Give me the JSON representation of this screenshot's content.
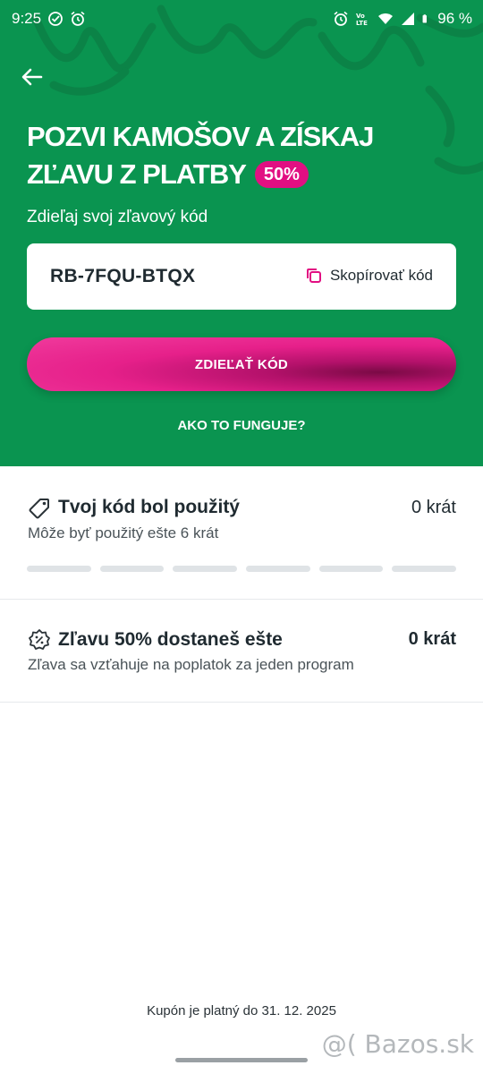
{
  "status_bar": {
    "time": "9:25",
    "battery": "96 %",
    "network": "Vo LTE"
  },
  "hero": {
    "title_line1": "POZVI KAMOŠOV A ZÍSKAJ",
    "title_line2": "ZĽAVU Z PLATBY",
    "badge": "50%",
    "subtitle": "Zdieľaj svoj zľavový kód",
    "code": "RB-7FQU-BTQX",
    "copy_label": "Skopírovať kód",
    "share_label": "ZDIEĽAŤ KÓD",
    "how_label": "AKO TO FUNGUJE?"
  },
  "used_section": {
    "title": "Tvoj kód bol použitý",
    "count": "0 krát",
    "subtitle": "Môže byť použitý ešte 6 krát",
    "progress_total_segments": 6,
    "progress_filled_segments": 0
  },
  "discount_section": {
    "title": "Zľavu 50% dostaneš ešte",
    "count": "0 krát",
    "subtitle": "Zľava sa vzťahuje na poplatok za jeden program"
  },
  "footer": {
    "validity": "Kupón je platný do 31. 12. 2025",
    "watermark": "@( Bazos.sk"
  },
  "colors": {
    "hero_green": "#0a9450",
    "accent_magenta": "#e20f82",
    "text_dark": "#1f2a30"
  },
  "icons": {
    "back": "arrow-left-icon",
    "copy": "copy-icon",
    "tag": "tag-icon",
    "discount": "discount-badge-icon"
  }
}
